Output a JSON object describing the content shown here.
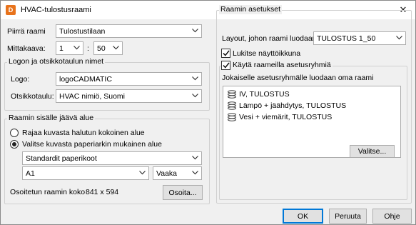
{
  "window": {
    "title": "HVAC-tulostusraami",
    "app_icon_letter": "D"
  },
  "left": {
    "piirra_raami_label": "Piirrä raami",
    "piirra_raami_value": "Tulostustilaan",
    "mittakaava_label": "Mittakaava:",
    "scale_left": "1",
    "scale_sep": ":",
    "scale_right": "50",
    "logo_group": {
      "title": "Logon ja otsikkotaulun nimet",
      "logo_label": "Logo:",
      "logo_value": "logoCADMATIC",
      "otsikkotaulu_label": "Otsikkotaulu:",
      "otsikkotaulu_value": "HVAC nimiö, Suomi"
    },
    "area_group": {
      "title": "Raamin sisälle jäävä alue",
      "radio1_label": "Rajaa kuvasta halutun kokoinen alue",
      "radio2_label": "Valitse kuvasta paperiarkin mukainen alue",
      "paper_set_value": "Standardit paperikoot",
      "paper_size_value": "A1",
      "orientation_value": "Vaaka",
      "frame_size_label": "Osoitetun raamin koko",
      "frame_size_value": "841 x 594",
      "osoita_button": "Osoita..."
    }
  },
  "right": {
    "group_title": "Raamin asetukset",
    "layout_label": "Layout, johon raami luodaan:",
    "layout_value": "TULOSTUS 1_50",
    "lock_label": "Lukitse näyttöikkuna",
    "use_layers_label": "Käytä raameilla asetusryhmiä",
    "layers_hint": "Jokaiselle asetusryhmälle luodaan oma raami",
    "layer_items": [
      "IV, TULOSTUS",
      "Lämpö + jäähdytys, TULOSTUS",
      "Vesi + viemärit, TULOSTUS"
    ],
    "valitse_button": "Valitse..."
  },
  "footer": {
    "ok": "OK",
    "cancel": "Peruuta",
    "help": "Ohje"
  },
  "colors": {
    "accent": "#0078d7",
    "app_icon": "#e8731c"
  }
}
